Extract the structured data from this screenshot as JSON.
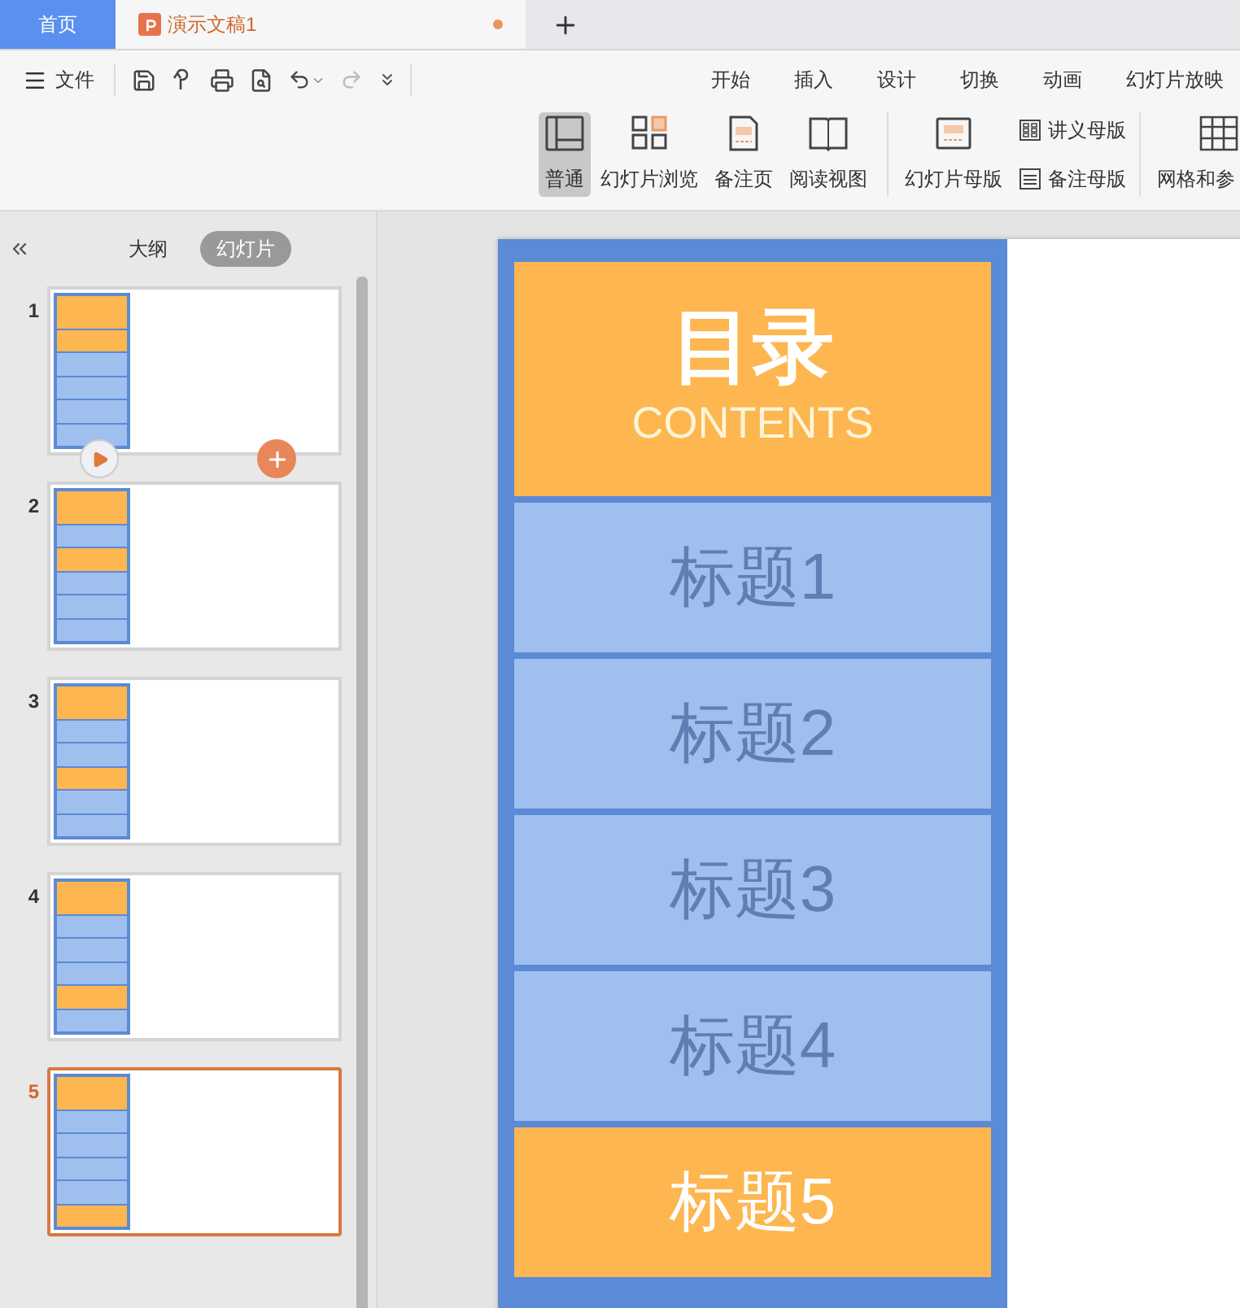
{
  "tabs": [
    {
      "label": "首页",
      "kind": "home",
      "selected": false
    },
    {
      "label": "演示文稿1",
      "kind": "document",
      "selected": true,
      "modified": true
    }
  ],
  "quick_access": {
    "file_menu": "文件"
  },
  "menu": [
    "开始",
    "插入",
    "设计",
    "切换",
    "动画",
    "幻灯片放映"
  ],
  "ribbon": [
    {
      "label": "普通",
      "selected": true
    },
    {
      "label": "幻灯片浏览",
      "selected": false
    },
    {
      "label": "备注页",
      "selected": false
    },
    {
      "label": "阅读视图",
      "selected": false
    },
    {
      "label": "幻灯片母版",
      "selected": false
    }
  ],
  "ribbon_small": [
    {
      "label": "讲义母版"
    },
    {
      "label": "备注母版"
    }
  ],
  "ribbon_cut": {
    "label": "网格和参"
  },
  "panel": {
    "tabs": [
      {
        "label": "大纲",
        "selected": false
      },
      {
        "label": "幻灯片",
        "selected": true
      }
    ]
  },
  "slides": [
    {
      "number": "1",
      "selected": false,
      "hovered": true,
      "highlighted": [
        true,
        false,
        false,
        false,
        false
      ]
    },
    {
      "number": "2",
      "selected": false,
      "hovered": false,
      "highlighted": [
        false,
        true,
        false,
        false,
        false
      ]
    },
    {
      "number": "3",
      "selected": false,
      "hovered": false,
      "highlighted": [
        false,
        false,
        true,
        false,
        false
      ]
    },
    {
      "number": "4",
      "selected": false,
      "hovered": false,
      "highlighted": [
        false,
        false,
        false,
        true,
        false
      ]
    },
    {
      "number": "5",
      "selected": true,
      "hovered": false,
      "highlighted": [
        false,
        false,
        false,
        false,
        true
      ]
    }
  ],
  "slide": {
    "title": "目录",
    "subtitle": "CONTENTS",
    "items": [
      {
        "label": "标题1",
        "highlighted": false
      },
      {
        "label": "标题2",
        "highlighted": false
      },
      {
        "label": "标题3",
        "highlighted": false
      },
      {
        "label": "标题4",
        "highlighted": false
      },
      {
        "label": "标题5",
        "highlighted": true
      }
    ]
  }
}
